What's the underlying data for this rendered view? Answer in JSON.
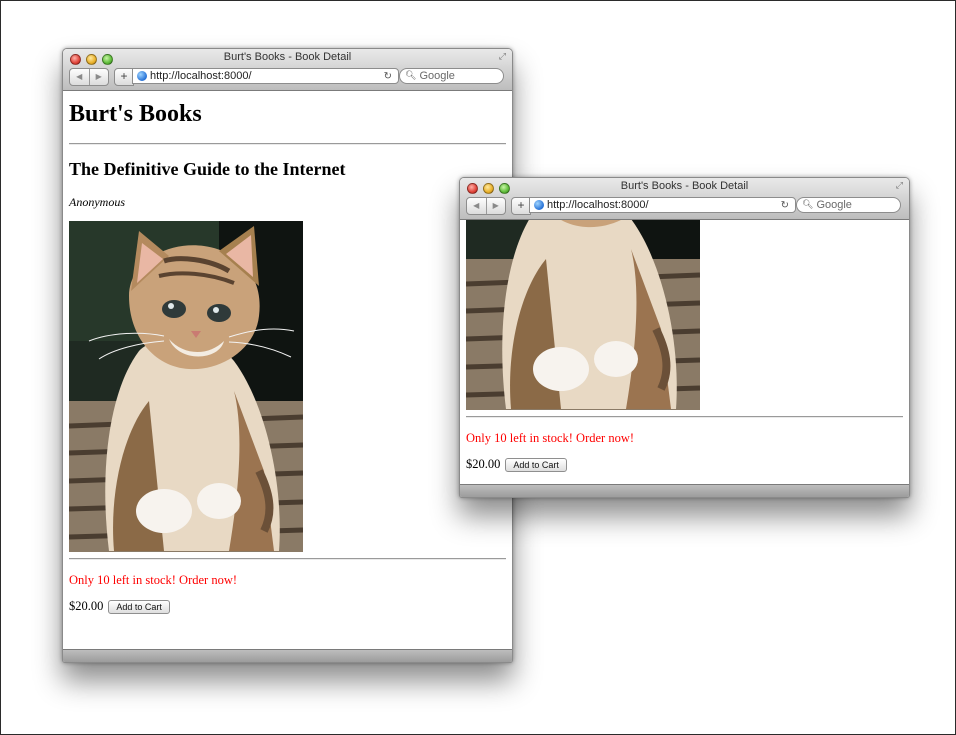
{
  "window_main": {
    "title": "Burt's Books - Book Detail",
    "url": "http://localhost:8000/",
    "search_placeholder": "Google",
    "site_title": "Burt's Books",
    "book_title": "The Definitive Guide to the Internet",
    "author": "Anonymous",
    "stock_message": "Only 10 left in stock! Order now!",
    "price": "$20.00",
    "add_to_cart_label": "Add to Cart"
  },
  "window_scrolled": {
    "title": "Burt's Books - Book Detail",
    "url": "http://localhost:8000/",
    "search_placeholder": "Google",
    "stock_message": "Only 10 left in stock! Order now!",
    "price": "$20.00",
    "add_to_cart_label": "Add to Cart"
  },
  "icons": {
    "back": "back-arrow-icon",
    "forward": "forward-arrow-icon",
    "add_bookmark": "plus-icon",
    "site": "globe-icon",
    "reload": "reload-icon",
    "search": "magnifier-icon",
    "resize": "fullscreen-icon"
  },
  "colors": {
    "stock_message": "#ff0000",
    "close_light": "#e0443a",
    "minimize_light": "#e9b12b",
    "zoom_light": "#5fbd3a"
  }
}
